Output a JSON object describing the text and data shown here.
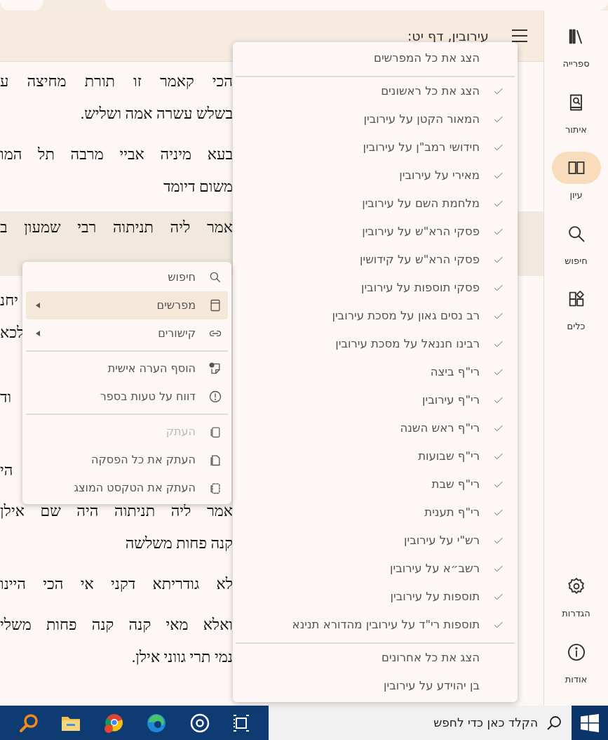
{
  "header": {
    "title": "עירובין, דף יט:"
  },
  "text": {
    "paragraphs": [
      {
        "highlighted": false,
        "lines": [
          {
            "kind": "full",
            "text": "הכי קאמר זו תורת מחיצה ע"
          },
          {
            "kind": "end",
            "text": "בשלש עשרה אמה ושליש."
          }
        ]
      },
      {
        "highlighted": false,
        "lines": [
          {
            "kind": "full",
            "text": "בעא מיניה אביי מרבה תל המו"
          },
          {
            "kind": "end",
            "text": "משום דיומד"
          }
        ]
      },
      {
        "highlighted": true,
        "lines": [
          {
            "kind": "full",
            "text": "אמר ליה תניתוה רבי שמעון ב"
          },
          {
            "kind": "covered"
          }
        ]
      },
      {
        "highlighted": false,
        "lines": [
          {
            "kind": "fragment",
            "text": "יחנ"
          },
          {
            "kind": "fragment",
            "text": "לכא"
          },
          {
            "kind": "covered"
          },
          {
            "kind": "fragment",
            "text": "וד"
          }
        ]
      },
      {
        "highlighted": false,
        "lines": [
          {
            "kind": "covered"
          },
          {
            "kind": "fragment",
            "text": "הי"
          }
        ]
      },
      {
        "highlighted": false,
        "lines": [
          {
            "kind": "full",
            "text": "אמר ליה תניתוה היה שם אילן"
          },
          {
            "kind": "end",
            "text": "קנה פחות משלשה"
          }
        ]
      },
      {
        "highlighted": false,
        "lines": [
          {
            "kind": "full",
            "text": "לא גודריתא דקני אי הכי היינו"
          }
        ]
      },
      {
        "highlighted": false,
        "lines": [
          {
            "kind": "full",
            "text": "ואלא מאי קנה קנה פחות משלי"
          },
          {
            "kind": "end",
            "text": "נמי תרי גווני אילן."
          }
        ]
      }
    ]
  },
  "sidebar": {
    "top_items": [
      {
        "label": "ספרייה",
        "selected": false
      },
      {
        "label": "איתור",
        "selected": false
      },
      {
        "label": "עיון",
        "selected": true
      },
      {
        "label": "חיפוש",
        "selected": false
      },
      {
        "label": "כלים",
        "selected": false
      }
    ],
    "bottom_items": [
      {
        "label": "הגדרות",
        "selected": false
      },
      {
        "label": "אודות",
        "selected": false
      }
    ]
  },
  "commentators_menu": {
    "show_all": "הצג את כל המפרשים",
    "items": [
      {
        "label": "הצג את כל ראשונים",
        "checked": true
      },
      {
        "label": "המאור הקטן על עירובין",
        "checked": true
      },
      {
        "label": "חידושי רמב\"ן על עירובין",
        "checked": true
      },
      {
        "label": "מאירי על עירובין",
        "checked": true
      },
      {
        "label": "מלחמת השם על עירובין",
        "checked": true
      },
      {
        "label": "פסקי הרא\"ש על עירובין",
        "checked": true
      },
      {
        "label": "פסקי הרא\"ש על קידושין",
        "checked": true
      },
      {
        "label": "פסקי תוספות על עירובין",
        "checked": true
      },
      {
        "label": "רב נסים גאון על מסכת עירובין",
        "checked": true
      },
      {
        "label": "רבינו חננאל על מסכת עירובין",
        "checked": true
      },
      {
        "label": "רי\"ף ביצה",
        "checked": true
      },
      {
        "label": "רי\"ף עירובין",
        "checked": true
      },
      {
        "label": "רי\"ף ראש השנה",
        "checked": true
      },
      {
        "label": "רי\"ף שבועות",
        "checked": true
      },
      {
        "label": "רי\"ף שבת",
        "checked": true
      },
      {
        "label": "רי\"ף תענית",
        "checked": true
      },
      {
        "label": "רש\"י על עירובין",
        "checked": true
      },
      {
        "label": "רשב״א על עירובין",
        "checked": true
      },
      {
        "label": "תוספות על עירובין",
        "checked": true
      },
      {
        "label": "תוספות רי\"ד על עירובין מהדורא תנינא",
        "checked": true
      }
    ],
    "later": [
      {
        "label": "הצג את כל אחרונים"
      },
      {
        "label": "בן יהוידע על עירובין"
      }
    ]
  },
  "context_menu": {
    "items": [
      {
        "kind": "item",
        "label": "חיפוש",
        "submenu": false,
        "selected": false,
        "disabled": false
      },
      {
        "kind": "item",
        "label": "מפרשים",
        "submenu": true,
        "selected": true,
        "disabled": false
      },
      {
        "kind": "item",
        "label": "קישורים",
        "submenu": true,
        "selected": false,
        "disabled": false
      },
      {
        "kind": "divider"
      },
      {
        "kind": "item",
        "label": "הוסף הערה אישית",
        "submenu": false,
        "selected": false,
        "disabled": false
      },
      {
        "kind": "item",
        "label": "דווח על טעות בספר",
        "submenu": false,
        "selected": false,
        "disabled": false
      },
      {
        "kind": "divider"
      },
      {
        "kind": "item",
        "label": "העתק",
        "submenu": false,
        "selected": false,
        "disabled": true
      },
      {
        "kind": "item",
        "label": "העתק את כל הפסקה",
        "submenu": false,
        "selected": false,
        "disabled": false
      },
      {
        "kind": "item",
        "label": "העתק את הטקסט המוצג",
        "submenu": false,
        "selected": false,
        "disabled": false
      }
    ]
  },
  "taskbar": {
    "search": {
      "placeholder": "הקלד כאן כדי לחפש"
    }
  }
}
